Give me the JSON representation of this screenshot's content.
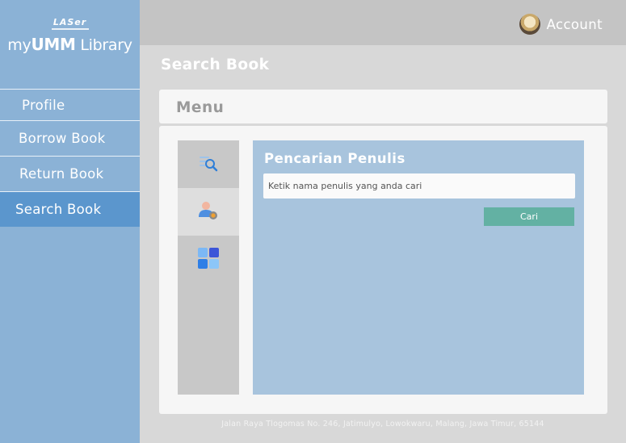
{
  "brand": {
    "mark": "LASer",
    "title_prefix": "my",
    "title_bold": "UMM",
    "title_suffix": " Library"
  },
  "sidebar": {
    "items": [
      {
        "label": "Profile"
      },
      {
        "label": "Borrow Book"
      },
      {
        "label": "Return Book"
      },
      {
        "label": "Search Book",
        "active": true
      }
    ]
  },
  "header": {
    "account_label": "Account"
  },
  "page_title": "Search Book",
  "menu": {
    "title": "Menu",
    "tools": [
      {
        "icon": "search-list-icon"
      },
      {
        "icon": "author-search-icon",
        "active": true
      },
      {
        "icon": "grid-icon"
      }
    ]
  },
  "form": {
    "title": "Pencarian Penulis",
    "input_placeholder": "Ketik nama penulis yang anda cari",
    "button_label": "Cari"
  },
  "footer": {
    "address": "Jalan Raya Tlogomas No. 246, Jatimulyo, Lowokwaru, Malang, Jawa Timur, 65144"
  },
  "colors": {
    "sidebar": "#8bb2d6",
    "sidebar_active": "#5b96cd",
    "topbar": "#c4c4c4",
    "form_panel": "#a8c4dd",
    "button": "#63b1a3"
  }
}
